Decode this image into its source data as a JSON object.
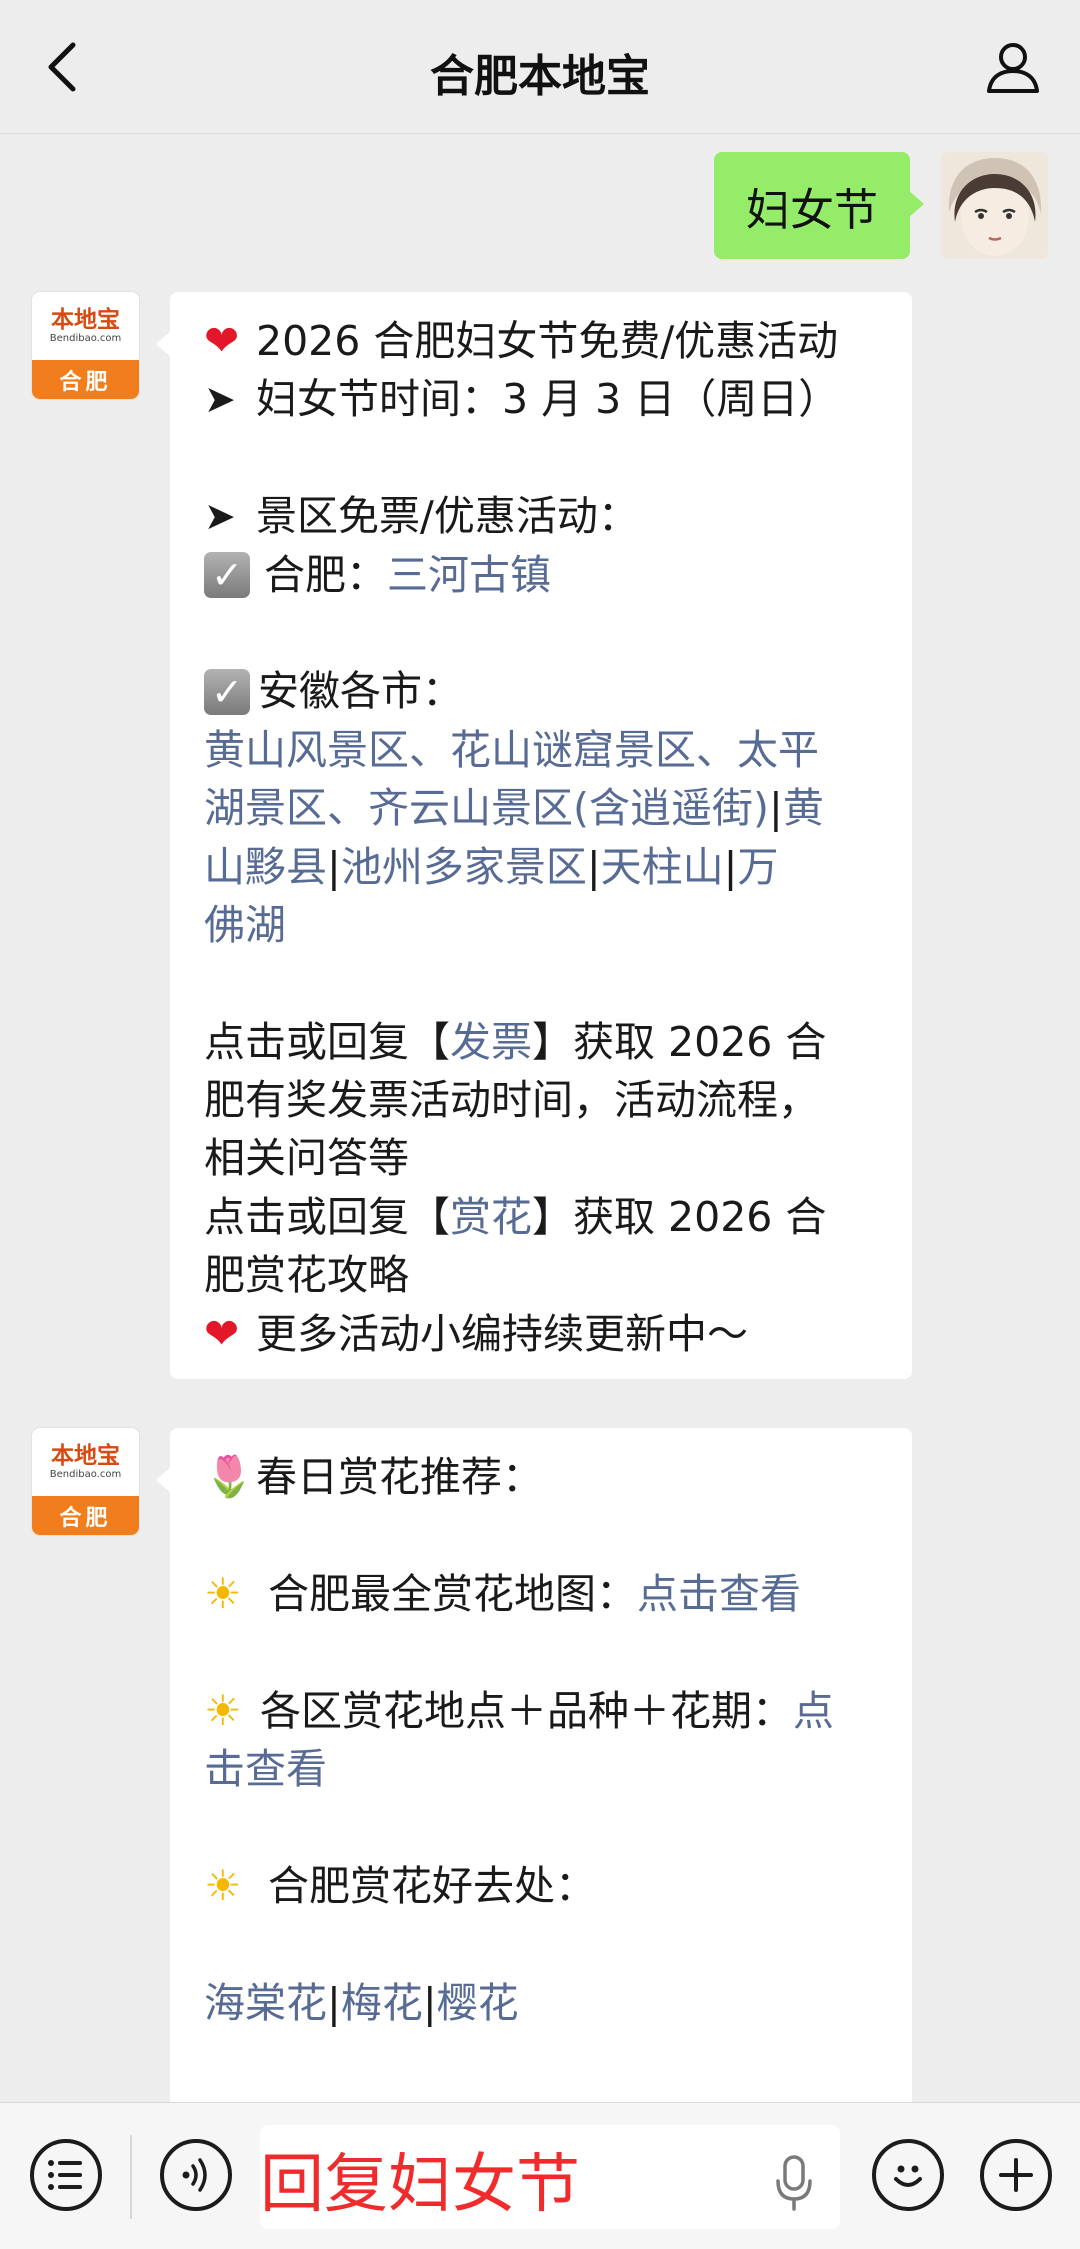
{
  "header": {
    "title": "合肥本地宝"
  },
  "outgoing_message": {
    "text": "妇女节"
  },
  "bot": {
    "avatar_brand": "本地宝",
    "avatar_site": "Bendibao.com",
    "avatar_city": "合肥"
  },
  "message1": {
    "title": "2026 合肥妇女节免费/优惠活动",
    "date_line": "妇女节时间：3 月 3 日（周日）",
    "scenic_heading": "景区免票/优惠活动：",
    "hefei_label": "合肥：",
    "hefei_link": "三河古镇",
    "anhui_label": "安徽各市：",
    "anhui_line1": "黄山风景区、花山谜窟景区、太平",
    "anhui_line2a": "湖景区、齐云山景区(含逍遥街)",
    "anhui_line2b": "黄",
    "anhui_line3a": "山黟县",
    "anhui_line3b": "池州多家景区",
    "anhui_line3c": "天柱山",
    "anhui_line3d": "万",
    "anhui_line4": "佛湖",
    "sep": " | ",
    "invoice_pre": "点击或回复【",
    "invoice_link": "发票",
    "invoice_post": "】获取 2026 合",
    "invoice_line2": "肥有奖发票活动时间，活动流程，",
    "invoice_line3": "相关问答等",
    "flower_pre": "点击或回复【",
    "flower_link": "赏花",
    "flower_post": "】获取 2026 合",
    "flower_line2": "肥赏花攻略",
    "more": "更多活动小编持续更新中～"
  },
  "message2": {
    "heading": "春日赏花推荐：",
    "map_label": "合肥最全赏花地图：",
    "map_link": "点击查看",
    "district_label": "各区赏花地点＋品种＋花期：",
    "district_link_a": "点",
    "district_link_b": "击查看",
    "places_label": "合肥赏花好去处：",
    "flower_links": [
      "海棠花",
      "梅花",
      "樱花"
    ],
    "sep": " | "
  },
  "input": {
    "placeholder": "回复妇女节"
  },
  "icons": {
    "back": "chevron-left-icon",
    "profile": "person-icon",
    "menu": "list-icon",
    "voice": "voice-icon",
    "mic": "mic-icon",
    "emoji": "emoji-icon",
    "plus": "plus-icon"
  },
  "colors": {
    "background": "#ededed",
    "outgoing_bubble": "#95ec69",
    "link": "#576b95",
    "placeholder": "#f02b2b",
    "brand_orange": "#f27d1c"
  }
}
